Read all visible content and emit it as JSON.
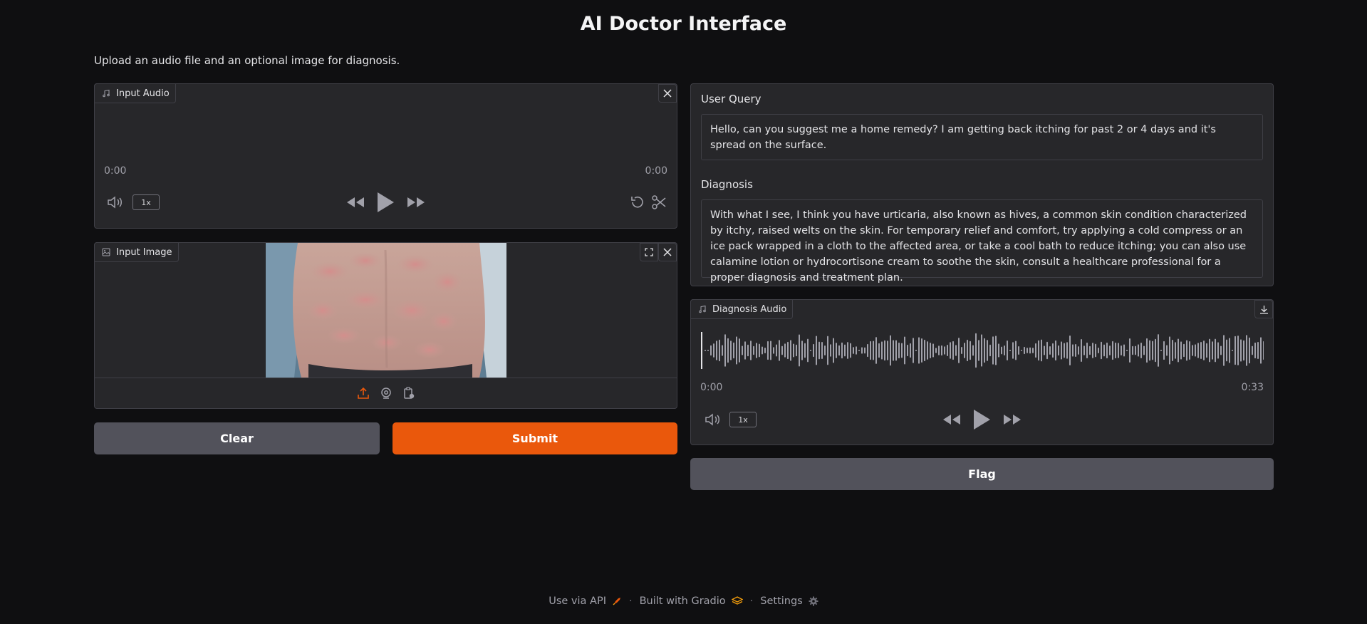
{
  "app": {
    "title": "AI Doctor Interface",
    "description": "Upload an audio file and an optional image for diagnosis."
  },
  "input_audio": {
    "label": "Input Audio",
    "time_current": "0:00",
    "time_total": "0:00",
    "speed": "1x"
  },
  "input_image": {
    "label": "Input Image",
    "image_description": "photo of back skin with raised red itchy welts"
  },
  "buttons": {
    "clear": "Clear",
    "submit": "Submit",
    "flag": "Flag"
  },
  "user_query": {
    "label": "User Query",
    "value": " Hello, can you suggest me a home remedy? I am getting back itching for past 2 or 4 days and it's spread on the surface."
  },
  "diagnosis": {
    "label": "Diagnosis",
    "value": "With what I see, I think you have urticaria, also known as hives, a common skin condition characterized by itchy, raised welts on the skin. For temporary relief and comfort, try applying a cold compress or an ice pack wrapped in a cloth to the affected area, or take a cool bath to reduce itching; you can also use calamine lotion or hydrocortisone cream to soothe the skin, consult a healthcare professional for a proper diagnosis and treatment plan."
  },
  "diagnosis_audio": {
    "label": "Diagnosis Audio",
    "time_current": "0:00",
    "time_total": "0:33",
    "speed": "1x"
  },
  "footer": {
    "api": "Use via API",
    "built": "Built with Gradio",
    "settings": "Settings",
    "separator": "·"
  },
  "colors": {
    "accent": "#ea580c",
    "background": "#0f0f11",
    "panel": "#27272a",
    "border": "#3f3f46"
  }
}
